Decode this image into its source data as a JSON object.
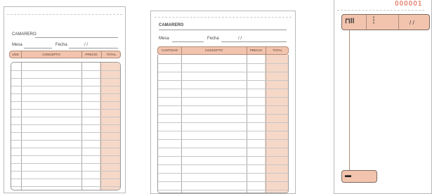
{
  "forms": [
    {
      "waiter_label": "CAMARERO",
      "table_label": "Mesa",
      "date_label": "Fecha",
      "date_placeholder": "/          /",
      "columns": [
        "UDS",
        "CONCEPTO",
        "PRECIO",
        "TOTAL"
      ]
    },
    {
      "waiter_label": "CAMARERO",
      "table_label": "Mesa",
      "date_label": "Fecha",
      "date_placeholder": "/          /",
      "columns": [
        "CANTIDAD",
        "CONCEPTO",
        "PRECIO",
        "TOTAL"
      ]
    }
  ],
  "stub": {
    "serial_number": "000001",
    "table_glyph": "⊓ll",
    "people_glyph": "┆",
    "date_placeholder": "/    /",
    "bottom_label": "▬"
  },
  "colors": {
    "header_fill": "#f2c4ae",
    "total_column_fill": "#f6d8c8",
    "serial_number": "#e78575"
  }
}
